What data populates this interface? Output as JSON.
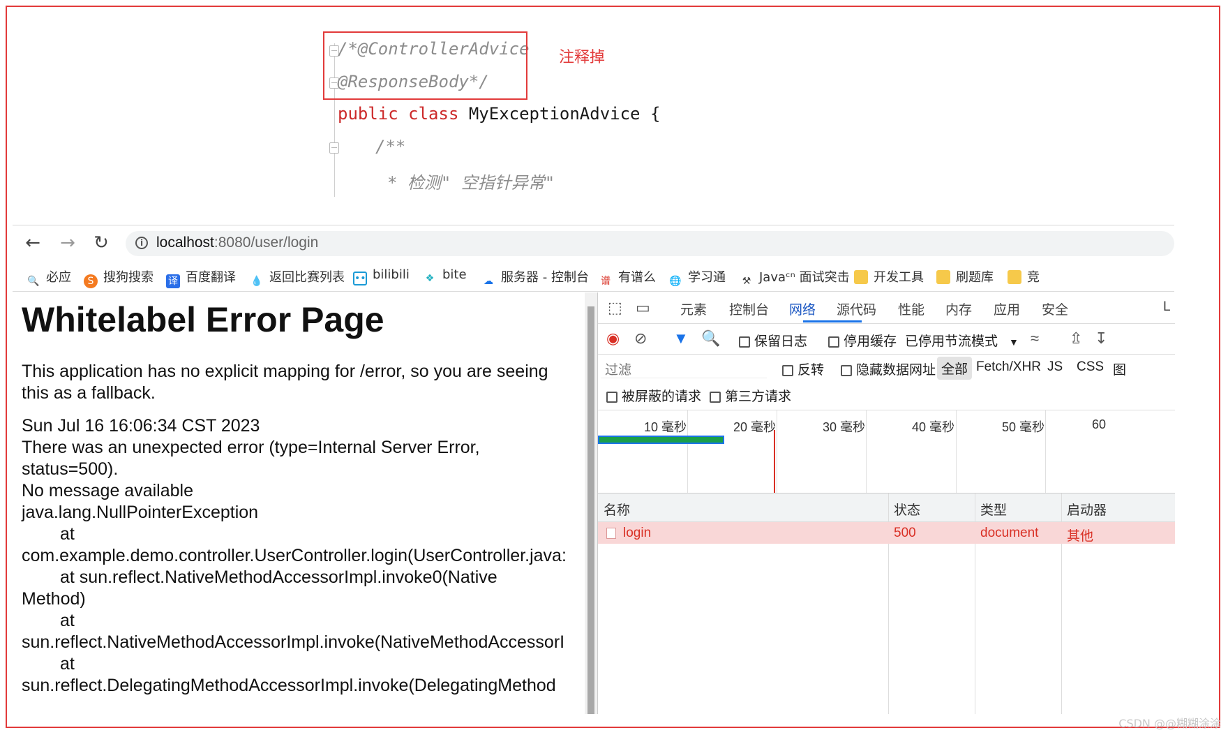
{
  "code": {
    "line1": "/*@ControllerAdvice",
    "line2": "@ResponseBody*/",
    "line3_kw1": "public",
    "line3_kw2": "class",
    "line3_name": "MyExceptionAdvice {",
    "line4": "/**",
    "line5": "* 检测\" 空指针异常\"",
    "annotation": "注释掉"
  },
  "browser": {
    "url_host": "localhost",
    "url_rest": ":8080/user/login",
    "bookmarks": [
      {
        "label": "必应",
        "icon": "search-icon"
      },
      {
        "label": "搜狗搜索",
        "icon": "sogou-icon"
      },
      {
        "label": "百度翻译",
        "icon": "translate-icon"
      },
      {
        "label": "返回比赛列表",
        "icon": "drop-icon"
      },
      {
        "label": "bilibili",
        "icon": "bilibili-icon"
      },
      {
        "label": "bite",
        "icon": "bite-icon"
      },
      {
        "label": "服务器 - 控制台",
        "icon": "cloud-icon"
      },
      {
        "label": "有谱么",
        "icon": "youpu-icon"
      },
      {
        "label": "学习通",
        "icon": "globe-icon"
      },
      {
        "label": "Javaᶜⁿ 面试突击",
        "icon": "hammer-icon"
      },
      {
        "label": "开发工具",
        "icon": "folder-icon"
      },
      {
        "label": "刷题库",
        "icon": "folder-icon"
      },
      {
        "label": "竞",
        "icon": "folder-icon"
      }
    ]
  },
  "page": {
    "title": "Whitelabel Error Page",
    "p1_line1": "This application has no explicit mapping for /error, so you are seeing",
    "p1_line2": "this as a fallback.",
    "date": "Sun Jul 16 16:06:34 CST 2023",
    "err1": "There was an unexpected error (type=Internal Server Error,",
    "err2": "status=500).",
    "msg": "No message available",
    "exc": "java.lang.NullPointerException",
    "at1": "at",
    "tr1": "com.example.demo.controller.UserController.login(UserController.java:",
    "tr2": "at sun.reflect.NativeMethodAccessorImpl.invoke0(Native",
    "tr2b": "Method)",
    "at2": "at",
    "tr3": "sun.reflect.NativeMethodAccessorImpl.invoke(NativeMethodAccessorI",
    "at3": "at",
    "tr4": "sun.reflect.DelegatingMethodAccessorImpl.invoke(DelegatingMethod"
  },
  "devtools": {
    "tabs": [
      "元素",
      "控制台",
      "网络",
      "源代码",
      "性能",
      "内存",
      "应用",
      "安全",
      "L"
    ],
    "active_tab": "网络",
    "preserve_log": "保留日志",
    "disable_cache": "停用缓存",
    "throttle": "已停用节流模式",
    "filter_placeholder": "过滤",
    "invert": "反转",
    "hide_data_urls": "隐藏数据网址",
    "type_all": "全部",
    "type_fetch": "Fetch/XHR",
    "type_js": "JS",
    "type_css": "CSS",
    "type_img": "图",
    "blocked": "被屏蔽的请求",
    "third_party": "第三方请求",
    "timeline_labels": [
      "10 毫秒",
      "20 毫秒",
      "30 毫秒",
      "40 毫秒",
      "50 毫秒",
      "60"
    ],
    "columns": [
      "名称",
      "状态",
      "类型",
      "启动器"
    ],
    "row": {
      "name": "login",
      "status": "500",
      "type": "document",
      "initiator": "其他"
    }
  },
  "watermark": "CSDN @@糊糊涂涂"
}
